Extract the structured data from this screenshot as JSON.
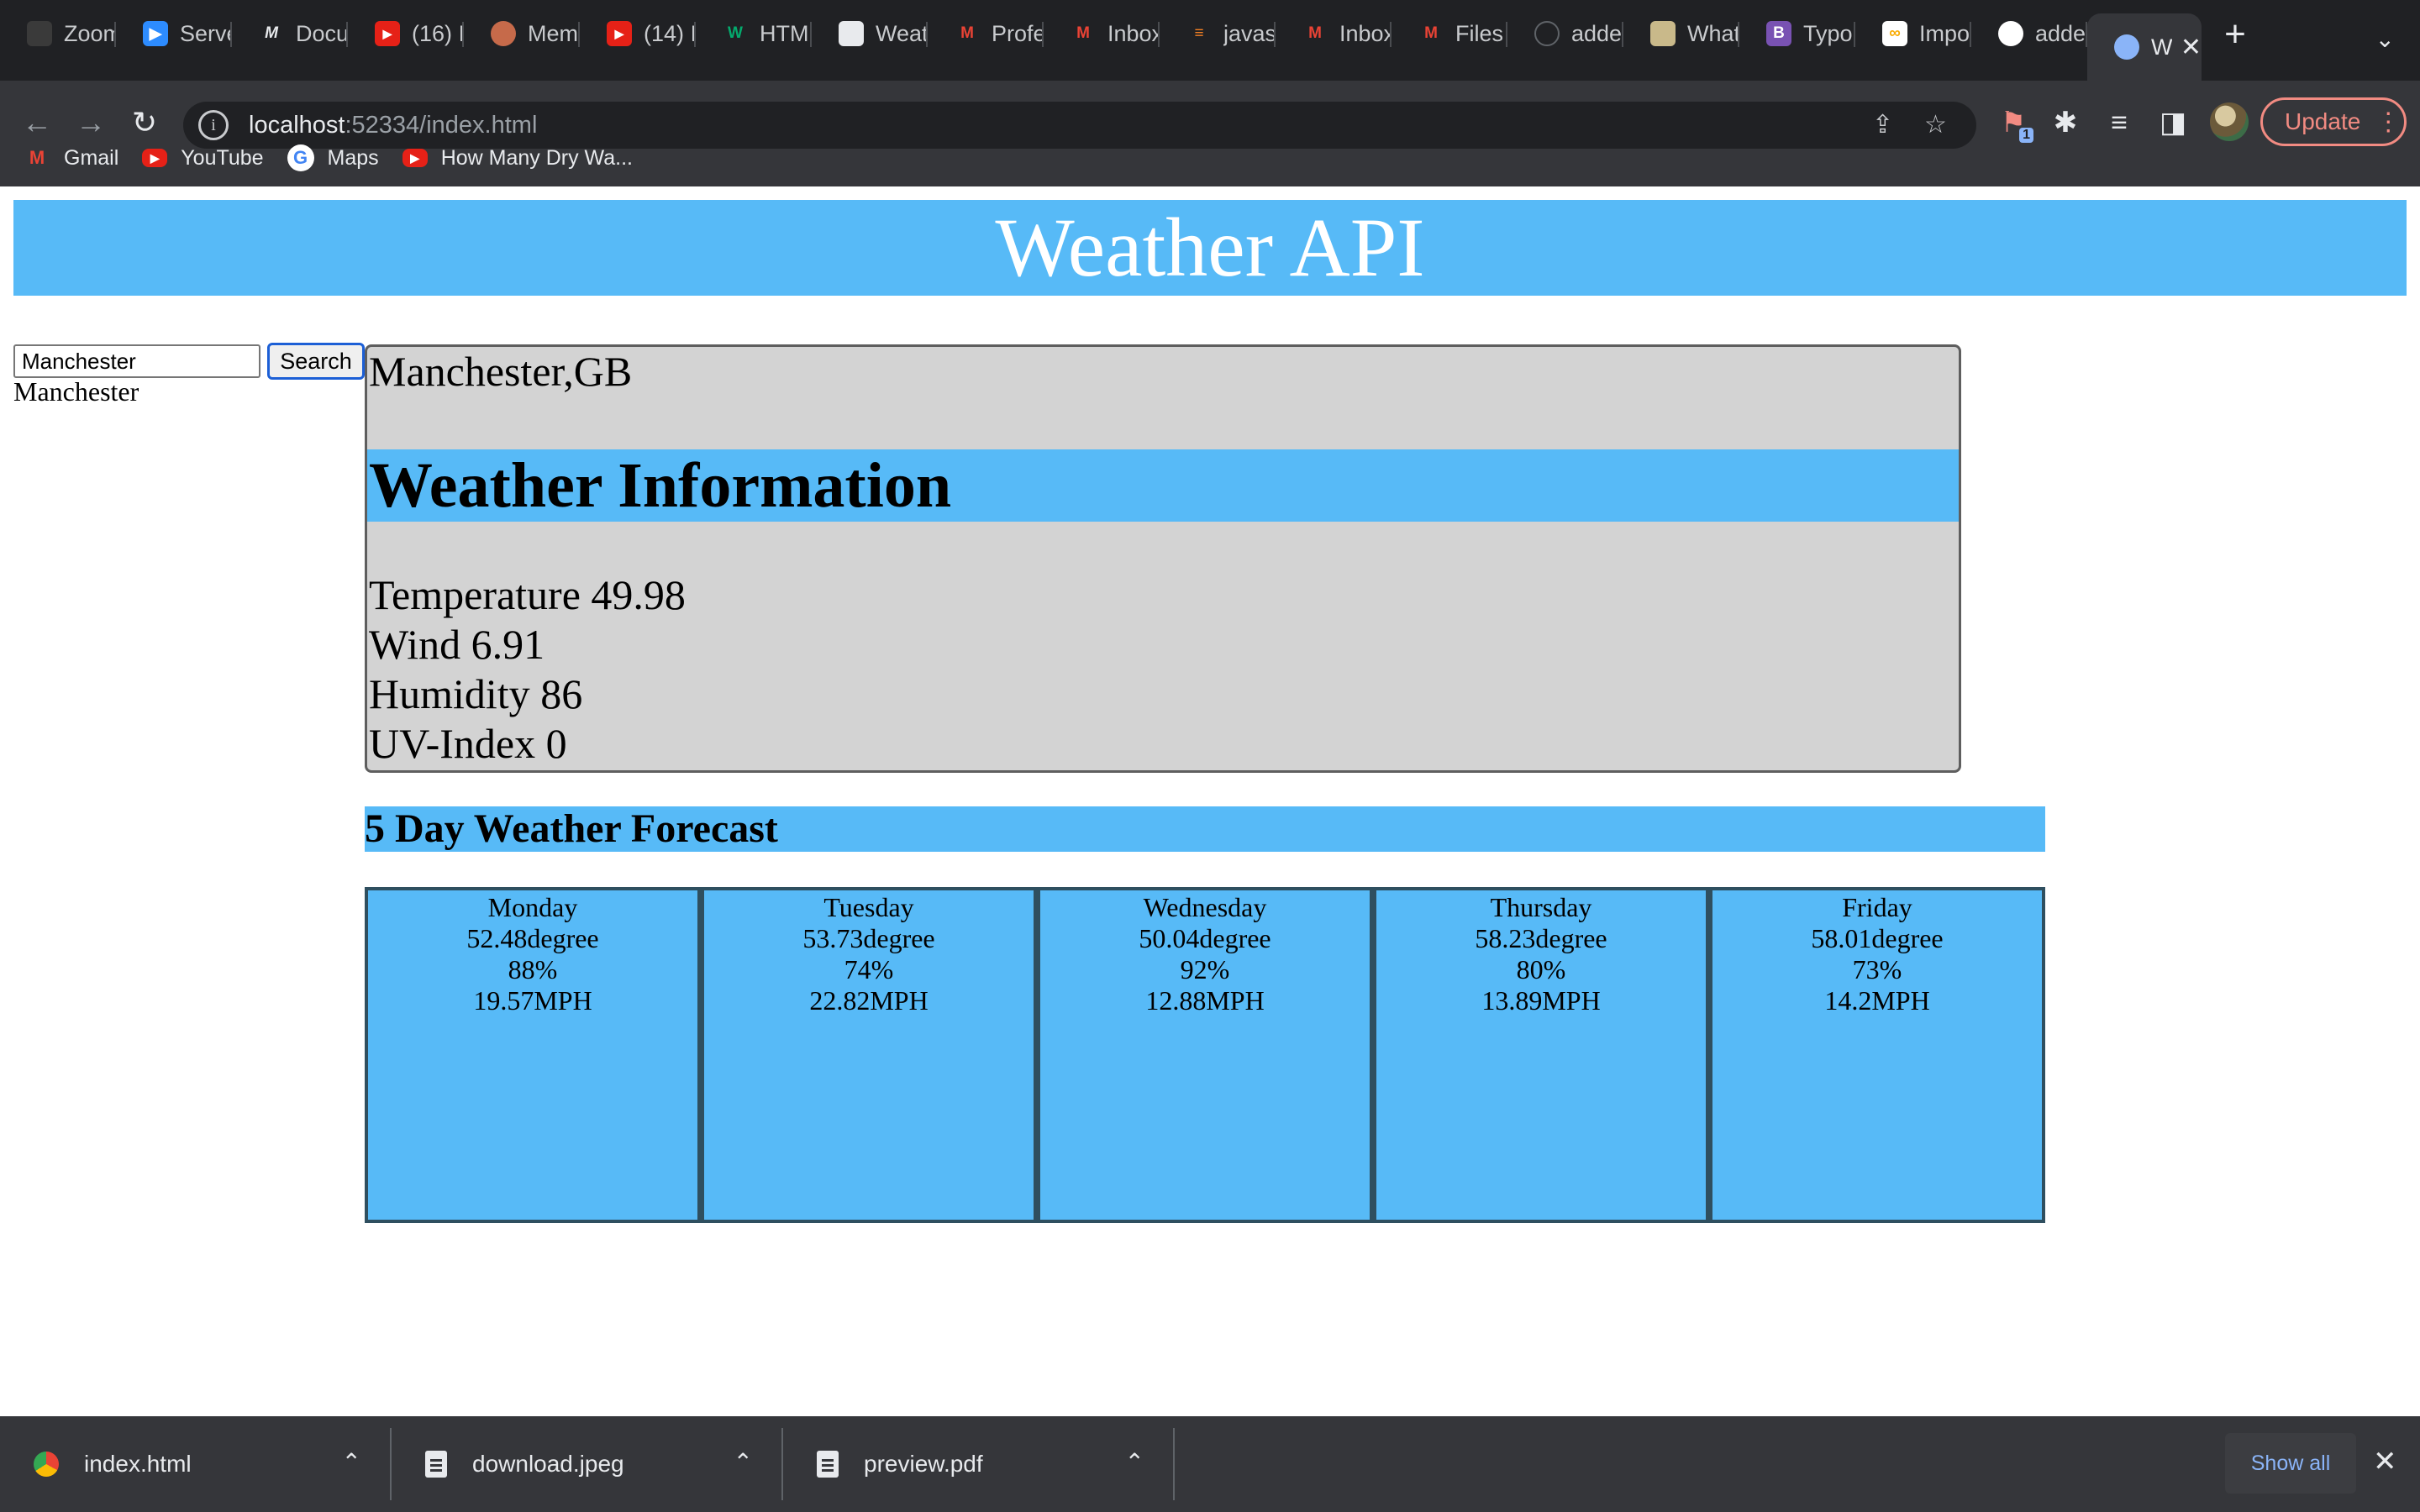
{
  "browser": {
    "tabs": [
      {
        "label": "Zoom",
        "icon": "zoom-tab-icon",
        "color": "#3a3a3a"
      },
      {
        "label": "Serve",
        "icon": "video-icon",
        "color": "#2d8cff"
      },
      {
        "label": "Docu",
        "icon": "docs-m-icon",
        "color": "#202124"
      },
      {
        "label": "(16) I",
        "icon": "youtube-icon",
        "color": "#e62117"
      },
      {
        "label": "Mem",
        "icon": "avatar-icon",
        "color": "#c66a4a"
      },
      {
        "label": "(14) I",
        "icon": "youtube-icon",
        "color": "#e62117"
      },
      {
        "label": "HTML",
        "icon": "w3schools-icon",
        "color": "#04aa6d"
      },
      {
        "label": "Weat",
        "icon": "page-icon",
        "color": "#e8eaed"
      },
      {
        "label": "Profe",
        "icon": "gmail-icon",
        "color": "#ea4335"
      },
      {
        "label": "Inbox",
        "icon": "gmail-icon",
        "color": "#ea4335"
      },
      {
        "label": "javas",
        "icon": "stackoverflow-icon",
        "color": "#f48024"
      },
      {
        "label": "Inbox",
        "icon": "gmail-icon",
        "color": "#ea4335"
      },
      {
        "label": "Files",
        "icon": "gmail-icon",
        "color": "#ea4335"
      },
      {
        "label": "adde",
        "icon": "github-icon",
        "color": "#202124"
      },
      {
        "label": "What",
        "icon": "image-icon",
        "color": "#c9b98a"
      },
      {
        "label": "Typo",
        "icon": "bootstrap-icon",
        "color": "#7952b3"
      },
      {
        "label": "Impo",
        "icon": "colab-icon",
        "color": "#ffffff"
      },
      {
        "label": "adde",
        "icon": "github-icon",
        "color": "#ffffff"
      }
    ],
    "active_tab": {
      "label": "W",
      "close": "✕"
    },
    "new_tab": "+",
    "tab_menu": "⌄",
    "url_host": "localhost",
    "url_rest": ":52334/index.html",
    "update_label": "Update",
    "extension_badge": "1",
    "bookmarks": [
      {
        "label": "Gmail",
        "icon": "gmail-icon"
      },
      {
        "label": "YouTube",
        "icon": "youtube-icon"
      },
      {
        "label": "Maps",
        "icon": "google-icon"
      },
      {
        "label": "How Many Dry Wa...",
        "icon": "youtube-icon"
      }
    ]
  },
  "page": {
    "title": "Weather API",
    "search": {
      "value": "Manchester",
      "button_label": "Search"
    },
    "history": [
      "Manchester"
    ],
    "current": {
      "city": "Manchester,GB",
      "heading": "Weather Information",
      "metrics": [
        {
          "label": "Temperature",
          "value": "49.98"
        },
        {
          "label": "Wind",
          "value": "6.91"
        },
        {
          "label": "Humidity",
          "value": "86"
        },
        {
          "label": "UV-Index",
          "value": "0"
        }
      ]
    },
    "forecast_heading": "5 Day Weather Forecast",
    "forecast": [
      {
        "day": "Monday",
        "temp": "52.48degree",
        "humidity": "88%",
        "wind": "19.57MPH"
      },
      {
        "day": "Tuesday",
        "temp": "53.73degree",
        "humidity": "74%",
        "wind": "22.82MPH"
      },
      {
        "day": "Wednesday",
        "temp": "50.04degree",
        "humidity": "92%",
        "wind": "12.88MPH"
      },
      {
        "day": "Thursday",
        "temp": "58.23degree",
        "humidity": "80%",
        "wind": "13.89MPH"
      },
      {
        "day": "Friday",
        "temp": "58.01degree",
        "humidity": "73%",
        "wind": "14.2MPH"
      }
    ],
    "colors": {
      "accent": "#57baf7",
      "panel": "#d3d3d3"
    }
  },
  "downloads": {
    "items": [
      {
        "name": "index.html",
        "icon": "chrome-file-icon"
      },
      {
        "name": "download.jpeg",
        "icon": "document-icon"
      },
      {
        "name": "preview.pdf",
        "icon": "document-icon"
      }
    ],
    "show_all": "Show all",
    "close": "✕"
  }
}
